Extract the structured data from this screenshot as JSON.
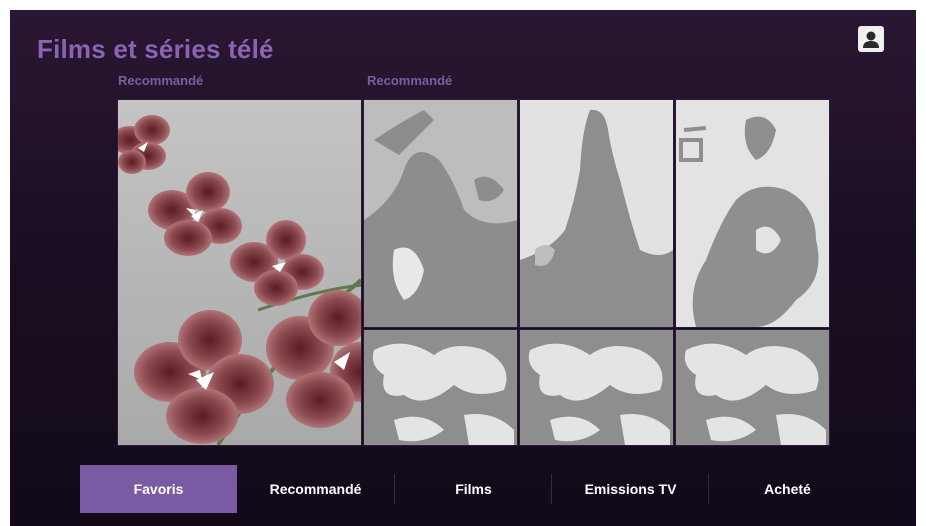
{
  "header": {
    "title": "Films et séries télé",
    "profile_icon": "user-profile-icon"
  },
  "sections": [
    {
      "label": "Recommandé"
    },
    {
      "label": "Recommandé"
    }
  ],
  "tiles": {
    "featured": {
      "art": "flower-artwork"
    },
    "grid": [
      {
        "art": "silhouette-artwork"
      },
      {
        "art": "silhouette-artwork"
      },
      {
        "art": "silhouette-artwork"
      },
      {
        "art": "map-pattern-artwork"
      },
      {
        "art": "map-pattern-artwork"
      },
      {
        "art": "map-pattern-artwork"
      }
    ]
  },
  "nav": {
    "tabs": [
      {
        "label": "Favoris",
        "active": true
      },
      {
        "label": "Recommandé",
        "active": false
      },
      {
        "label": "Films",
        "active": false
      },
      {
        "label": "Emissions TV",
        "active": false
      },
      {
        "label": "Acheté",
        "active": false
      }
    ]
  },
  "colors": {
    "accent": "#7a5aa3",
    "title": "#8a63b3",
    "background": "#1a0f22",
    "tile_gray": "#bcbcbc"
  }
}
